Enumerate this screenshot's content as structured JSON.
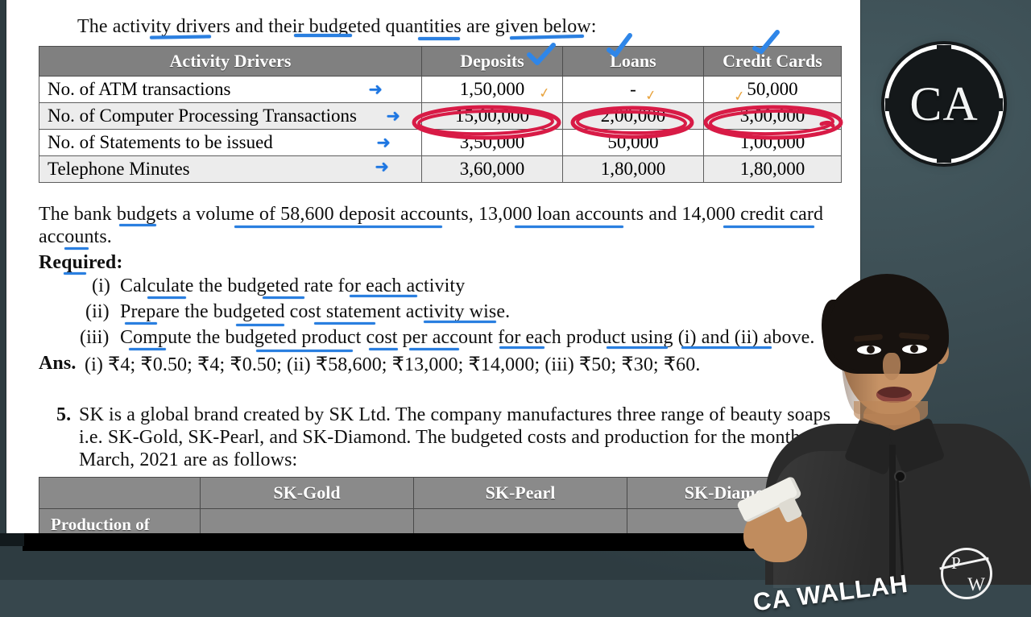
{
  "document": {
    "intro_line": "The activity drivers and their budgeted quantities are given below:",
    "table1": {
      "headers": [
        "Activity Drivers",
        "Deposits",
        "Loans",
        "Credit Cards"
      ],
      "rows": [
        {
          "label": "No. of ATM transactions",
          "deposits": "1,50,000",
          "loans": "-",
          "credit_cards": "50,000",
          "highlighted": false
        },
        {
          "label": "No. of Computer Processing Transactions",
          "deposits": "15,00,000",
          "loans": "2,00,000",
          "credit_cards": "3,00,000",
          "highlighted": true
        },
        {
          "label": "No. of Statements to be issued",
          "deposits": "3,50,000",
          "loans": "50,000",
          "credit_cards": "1,00,000",
          "highlighted": false
        },
        {
          "label": "Telephone Minutes",
          "deposits": "3,60,000",
          "loans": "1,80,000",
          "credit_cards": "1,80,000",
          "highlighted": false
        }
      ]
    },
    "body_line_1": "The bank budgets a volume of 58,600 deposit accounts, 13,000 loan accounts and 14,000 credit card",
    "body_line_2": "accounts.",
    "required_label": "Required:",
    "requirements": [
      {
        "num": "(i)",
        "text": "Calculate the budgeted rate for each activity"
      },
      {
        "num": "(ii)",
        "text": "Prepare the budgeted cost statement activity wise."
      },
      {
        "num": "(iii)",
        "text": "Compute the budgeted product cost per account for each product using (i) and (ii) above."
      }
    ],
    "answer_label": "Ans.",
    "answer_text": "(i) ₹4; ₹0.50; ₹4; ₹0.50; (ii) ₹58,600; ₹13,000; ₹14,000; (iii) ₹50; ₹30; ₹60.",
    "question5": {
      "number": "5.",
      "line1": "SK is a global brand created by SK Ltd.  The company manufactures three range of beauty soaps",
      "line2": "i.e. SK-Gold, SK-Pearl, and SK-Diamond.  The budgeted costs and production for the month",
      "line3": "March, 2021 are as follows:"
    },
    "table2": {
      "headers": [
        "",
        "SK-Gold",
        "SK-Pearl",
        "SK-Diamond"
      ],
      "rows": [
        {
          "label": "Production of",
          "gold": "",
          "pearl": "",
          "diamond": ""
        }
      ]
    }
  },
  "annotations": {
    "arrow_glyph": "➜",
    "tick_glyph": "✓",
    "circle_color": "#d81b46",
    "underline_color": "#2a7fe0",
    "arrow_color": "#1d76e2",
    "tick_color": "#e8a33d"
  },
  "branding": {
    "ca_logo_text": "CA",
    "shirt_text": "CA WALLAH",
    "pw_logo_p": "P",
    "pw_logo_w": "W"
  },
  "theme": {
    "background": "#37474d",
    "doc_background": "#ffffff",
    "table_header_bg": "#808080",
    "table_alt_row": "#ececec"
  }
}
